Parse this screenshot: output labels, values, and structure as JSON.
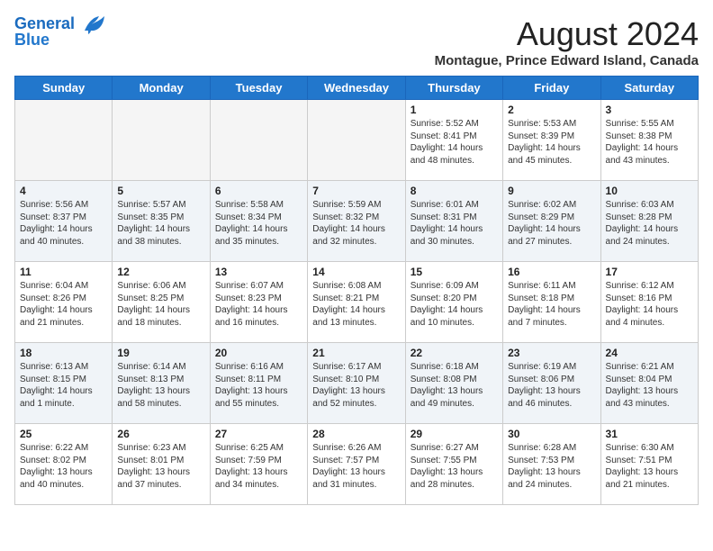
{
  "header": {
    "logo_line1": "General",
    "logo_line2": "Blue",
    "title": "August 2024",
    "subtitle": "Montague, Prince Edward Island, Canada"
  },
  "days_of_week": [
    "Sunday",
    "Monday",
    "Tuesday",
    "Wednesday",
    "Thursday",
    "Friday",
    "Saturday"
  ],
  "weeks": [
    [
      {
        "day": "",
        "text": ""
      },
      {
        "day": "",
        "text": ""
      },
      {
        "day": "",
        "text": ""
      },
      {
        "day": "",
        "text": ""
      },
      {
        "day": "1",
        "text": "Sunrise: 5:52 AM\nSunset: 8:41 PM\nDaylight: 14 hours\nand 48 minutes."
      },
      {
        "day": "2",
        "text": "Sunrise: 5:53 AM\nSunset: 8:39 PM\nDaylight: 14 hours\nand 45 minutes."
      },
      {
        "day": "3",
        "text": "Sunrise: 5:55 AM\nSunset: 8:38 PM\nDaylight: 14 hours\nand 43 minutes."
      }
    ],
    [
      {
        "day": "4",
        "text": "Sunrise: 5:56 AM\nSunset: 8:37 PM\nDaylight: 14 hours\nand 40 minutes."
      },
      {
        "day": "5",
        "text": "Sunrise: 5:57 AM\nSunset: 8:35 PM\nDaylight: 14 hours\nand 38 minutes."
      },
      {
        "day": "6",
        "text": "Sunrise: 5:58 AM\nSunset: 8:34 PM\nDaylight: 14 hours\nand 35 minutes."
      },
      {
        "day": "7",
        "text": "Sunrise: 5:59 AM\nSunset: 8:32 PM\nDaylight: 14 hours\nand 32 minutes."
      },
      {
        "day": "8",
        "text": "Sunrise: 6:01 AM\nSunset: 8:31 PM\nDaylight: 14 hours\nand 30 minutes."
      },
      {
        "day": "9",
        "text": "Sunrise: 6:02 AM\nSunset: 8:29 PM\nDaylight: 14 hours\nand 27 minutes."
      },
      {
        "day": "10",
        "text": "Sunrise: 6:03 AM\nSunset: 8:28 PM\nDaylight: 14 hours\nand 24 minutes."
      }
    ],
    [
      {
        "day": "11",
        "text": "Sunrise: 6:04 AM\nSunset: 8:26 PM\nDaylight: 14 hours\nand 21 minutes."
      },
      {
        "day": "12",
        "text": "Sunrise: 6:06 AM\nSunset: 8:25 PM\nDaylight: 14 hours\nand 18 minutes."
      },
      {
        "day": "13",
        "text": "Sunrise: 6:07 AM\nSunset: 8:23 PM\nDaylight: 14 hours\nand 16 minutes."
      },
      {
        "day": "14",
        "text": "Sunrise: 6:08 AM\nSunset: 8:21 PM\nDaylight: 14 hours\nand 13 minutes."
      },
      {
        "day": "15",
        "text": "Sunrise: 6:09 AM\nSunset: 8:20 PM\nDaylight: 14 hours\nand 10 minutes."
      },
      {
        "day": "16",
        "text": "Sunrise: 6:11 AM\nSunset: 8:18 PM\nDaylight: 14 hours\nand 7 minutes."
      },
      {
        "day": "17",
        "text": "Sunrise: 6:12 AM\nSunset: 8:16 PM\nDaylight: 14 hours\nand 4 minutes."
      }
    ],
    [
      {
        "day": "18",
        "text": "Sunrise: 6:13 AM\nSunset: 8:15 PM\nDaylight: 14 hours\nand 1 minute."
      },
      {
        "day": "19",
        "text": "Sunrise: 6:14 AM\nSunset: 8:13 PM\nDaylight: 13 hours\nand 58 minutes."
      },
      {
        "day": "20",
        "text": "Sunrise: 6:16 AM\nSunset: 8:11 PM\nDaylight: 13 hours\nand 55 minutes."
      },
      {
        "day": "21",
        "text": "Sunrise: 6:17 AM\nSunset: 8:10 PM\nDaylight: 13 hours\nand 52 minutes."
      },
      {
        "day": "22",
        "text": "Sunrise: 6:18 AM\nSunset: 8:08 PM\nDaylight: 13 hours\nand 49 minutes."
      },
      {
        "day": "23",
        "text": "Sunrise: 6:19 AM\nSunset: 8:06 PM\nDaylight: 13 hours\nand 46 minutes."
      },
      {
        "day": "24",
        "text": "Sunrise: 6:21 AM\nSunset: 8:04 PM\nDaylight: 13 hours\nand 43 minutes."
      }
    ],
    [
      {
        "day": "25",
        "text": "Sunrise: 6:22 AM\nSunset: 8:02 PM\nDaylight: 13 hours\nand 40 minutes."
      },
      {
        "day": "26",
        "text": "Sunrise: 6:23 AM\nSunset: 8:01 PM\nDaylight: 13 hours\nand 37 minutes."
      },
      {
        "day": "27",
        "text": "Sunrise: 6:25 AM\nSunset: 7:59 PM\nDaylight: 13 hours\nand 34 minutes."
      },
      {
        "day": "28",
        "text": "Sunrise: 6:26 AM\nSunset: 7:57 PM\nDaylight: 13 hours\nand 31 minutes."
      },
      {
        "day": "29",
        "text": "Sunrise: 6:27 AM\nSunset: 7:55 PM\nDaylight: 13 hours\nand 28 minutes."
      },
      {
        "day": "30",
        "text": "Sunrise: 6:28 AM\nSunset: 7:53 PM\nDaylight: 13 hours\nand 24 minutes."
      },
      {
        "day": "31",
        "text": "Sunrise: 6:30 AM\nSunset: 7:51 PM\nDaylight: 13 hours\nand 21 minutes."
      }
    ]
  ]
}
